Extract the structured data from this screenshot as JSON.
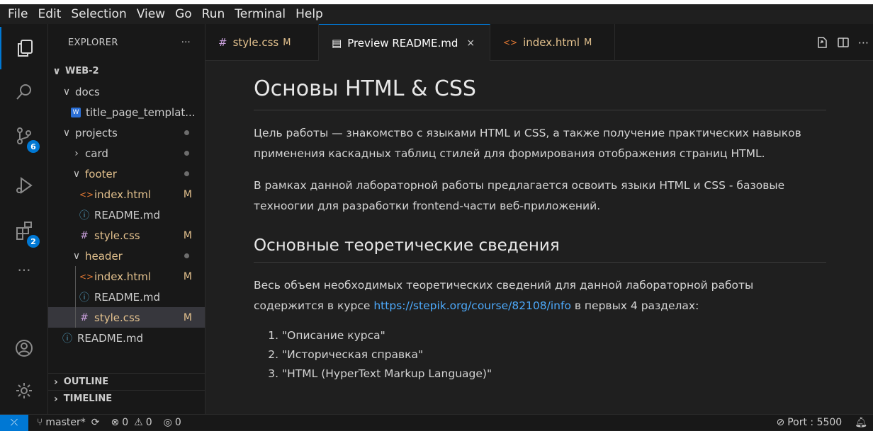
{
  "menu": [
    "File",
    "Edit",
    "Selection",
    "View",
    "Go",
    "Run",
    "Terminal",
    "Help"
  ],
  "activity": {
    "source_control_badge": "6",
    "extensions_badge": "2",
    "accent_color": "#0078d4"
  },
  "explorer": {
    "title": "EXPLORER",
    "more": "···",
    "root": "WEB-2",
    "items": [
      {
        "label": "docs"
      },
      {
        "label": "title_page_templat..."
      },
      {
        "label": "projects"
      },
      {
        "label": "card"
      },
      {
        "label": "footer"
      },
      {
        "label": "index.html",
        "status": "M"
      },
      {
        "label": "README.md"
      },
      {
        "label": "style.css",
        "status": "M"
      },
      {
        "label": "header"
      },
      {
        "label": "index.html",
        "status": "M"
      },
      {
        "label": "README.md"
      },
      {
        "label": "style.css",
        "status": "M"
      },
      {
        "label": "README.md"
      }
    ],
    "outline": "OUTLINE",
    "timeline": "TIMELINE"
  },
  "tabs": [
    {
      "icon": "#",
      "label": "style.css",
      "status": "M"
    },
    {
      "icon": "▤",
      "label": "Preview README.md",
      "close": "×"
    },
    {
      "icon": "<>",
      "label": "index.html",
      "status": "M"
    }
  ],
  "preview": {
    "h1": "Основы HTML & CSS",
    "p1": "Цель работы — знакомство с языками HTML и CSS, а также получение практических навыков применения каскадных таблиц стилей для формирования отображения страниц HTML.",
    "p2": "В рамках данной лабораторной работы предлагается освоить языки HTML и CSS - базовые техноогии для разработки frontend-части веб-приложений.",
    "h2": "Основные теоретические сведения",
    "p3_before": "Весь объем необходимых теоретических сведений для данной лабораторной работы содержится в курсе ",
    "p3_link": "https://stepik.org/course/82108/info",
    "p3_after": " в первых 4 разделах:",
    "list": [
      "\"Описание курса\"",
      "\"Историческая справка\"",
      "\"HTML (HyperText Markup Language)\""
    ]
  },
  "status": {
    "branch": "master*",
    "errors": "0",
    "warnings": "0",
    "ports": "0",
    "port_label": "Port : 5500"
  }
}
